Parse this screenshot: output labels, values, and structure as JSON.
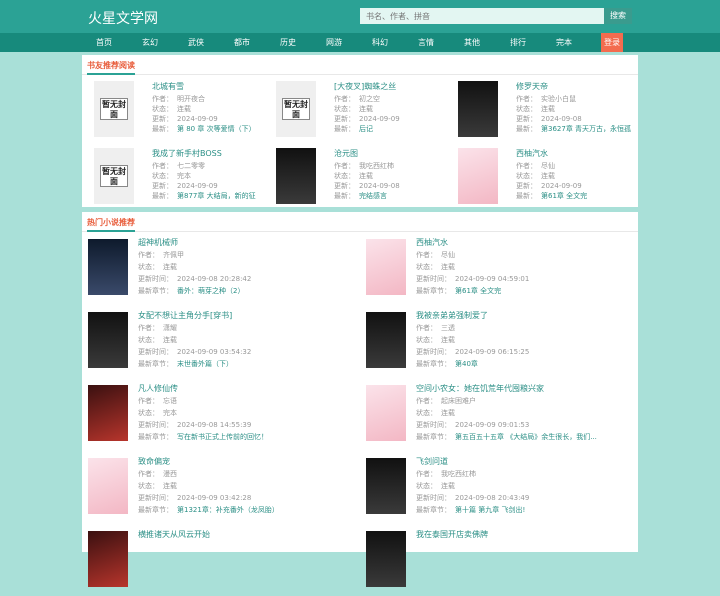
{
  "site": {
    "logo": "火星文学网",
    "search_placeholder": "书名、作者、拼音",
    "search_button": "搜索",
    "login": "登录"
  },
  "nav": [
    "首页",
    "玄幻",
    "武侠",
    "都市",
    "历史",
    "网游",
    "科幻",
    "言情",
    "其他",
    "排行",
    "完本"
  ],
  "labels": {
    "author": "作者：",
    "status": "状态：",
    "updated": "更新：",
    "latest": "最新：",
    "updated_long": "更新时间：",
    "latest_long": "最新章节："
  },
  "recommend": {
    "title": "书友推荐阅读",
    "books": [
      {
        "title": "北城有雪",
        "author": "明开夜合",
        "status": "连载",
        "date": "2024-09-09",
        "chapter": "第 80 章 次等爱情（下）",
        "cover": "placeholder",
        "cover_text": "暂无封面"
      },
      {
        "title": "[大夜叉]蜘蛛之丝",
        "author": "初之空",
        "status": "连载",
        "date": "2024-09-09",
        "chapter": "后记",
        "cover": "placeholder",
        "cover_text": "暂无封面"
      },
      {
        "title": "修罗天帝",
        "author": "实验小白鼠",
        "status": "连载",
        "date": "2024-09-08",
        "chapter": "第3627章 青天万古，永恒孤",
        "cover": "dark"
      },
      {
        "title": "我成了新手村BOSS",
        "author": "七二零零",
        "status": "完本",
        "date": "2024-09-09",
        "chapter": "第877章 大结局，新的征",
        "cover": "placeholder",
        "cover_text": "暂无封面"
      },
      {
        "title": "沧元图",
        "author": "我吃西红柿",
        "status": "连载",
        "date": "2024-09-08",
        "chapter": "完结感言",
        "cover": "dark"
      },
      {
        "title": "西柚汽水",
        "author": "尽仙",
        "status": "连载",
        "date": "2024-09-09",
        "chapter": "第61章 全文完",
        "cover": "pink"
      }
    ]
  },
  "hot": {
    "title": "热门小说推荐",
    "books": [
      {
        "title": "超神机械师",
        "author": "齐佩甲",
        "status": "连载",
        "time": "2024-09-08 20:28:42",
        "chapter": "番外：萌芽之种（2）",
        "cover": "blue"
      },
      {
        "title": "西柚汽水",
        "author": "尽仙",
        "status": "连载",
        "time": "2024-09-09 04:59:01",
        "chapter": "第61章 全文完",
        "cover": "pink"
      },
      {
        "title": "女配不想让主角分手[穿书]",
        "author": "潇耀",
        "status": "连载",
        "time": "2024-09-09 03:54:32",
        "chapter": "末世番外篇（下）",
        "cover": "dark"
      },
      {
        "title": "我被亲弟弟强制爱了",
        "author": "三透",
        "status": "连载",
        "time": "2024-09-09 06:15:25",
        "chapter": "第40章",
        "cover": "dark"
      },
      {
        "title": "凡人修仙传",
        "author": "忘语",
        "status": "完本",
        "time": "2024-09-08 14:55:39",
        "chapter": "写在新书正式上传前的回忆！",
        "cover": "red"
      },
      {
        "title": "空间小农女：她在饥荒年代囤粮兴家",
        "author": "起床困难户",
        "status": "连载",
        "time": "2024-09-09 09:01:53",
        "chapter": "第五百五十五章 《大结局》余生很长，我们...",
        "cover": "pink"
      },
      {
        "title": "致命偏宠",
        "author": "漫西",
        "status": "连载",
        "time": "2024-09-09 03:42:28",
        "chapter": "第1321章：补充番外（龙凤胎）",
        "cover": "pink"
      },
      {
        "title": "飞剑问道",
        "author": "我吃西红柿",
        "status": "连载",
        "time": "2024-09-08 20:43:49",
        "chapter": "第十篇 第九章 飞剑出!",
        "cover": "dark"
      },
      {
        "title": "横推诸天从风云开始",
        "cover": "red"
      },
      {
        "title": "我在泰国开店卖佛牌",
        "cover": "dark"
      }
    ]
  },
  "colors": {
    "header": "#2ba295",
    "nav": "#178a7c",
    "accent": "#e85c3a",
    "link": "#2b8f86",
    "login": "#f36c4f"
  }
}
